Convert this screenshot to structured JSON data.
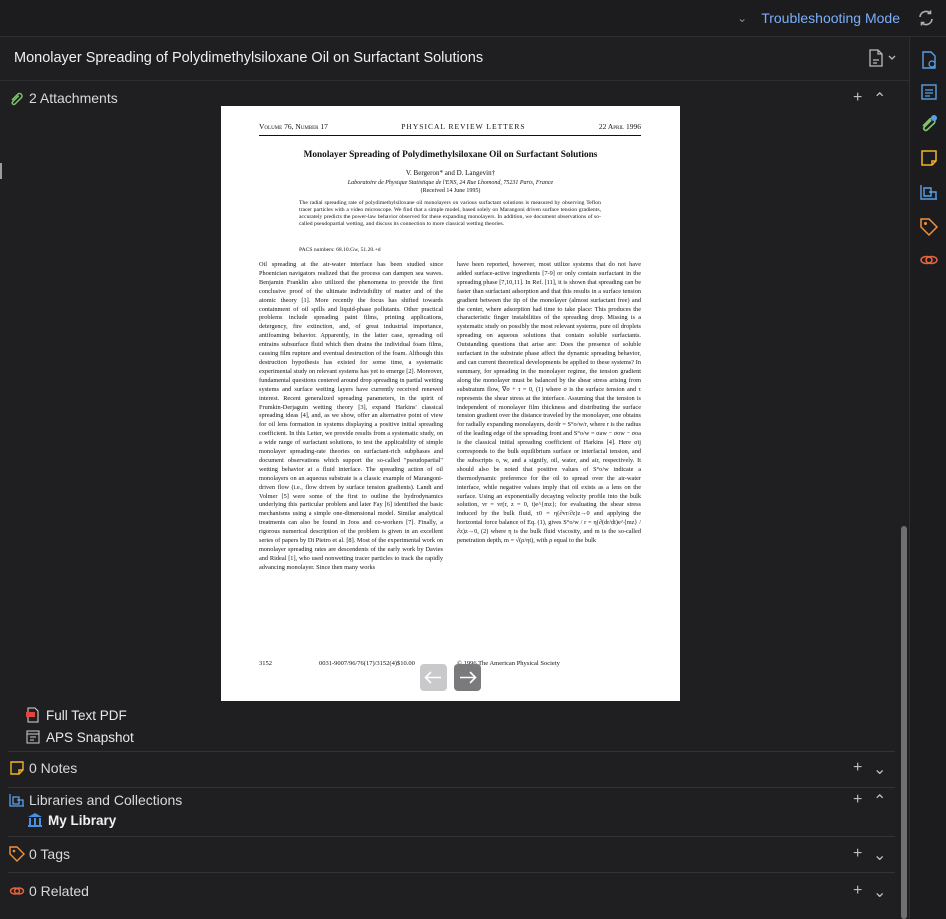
{
  "topbar": {
    "mode_label": "Troubleshooting Mode",
    "chevron_icon": "chevron-down-icon",
    "refresh_icon": "sync-icon"
  },
  "item": {
    "title": "Monolayer Spreading of Polydimethylsiloxane Oil on Surfactant Solutions"
  },
  "sections": {
    "attachments": {
      "label": "2 Attachments"
    },
    "notes": {
      "label": "0 Notes"
    },
    "libraries": {
      "label": "Libraries and Collections"
    },
    "tags": {
      "label": "0 Tags"
    },
    "related": {
      "label": "0 Related"
    }
  },
  "attachments": [
    {
      "label": "Full Text PDF",
      "icon": "pdf-icon"
    },
    {
      "label": "APS Snapshot",
      "icon": "snapshot-icon"
    }
  ],
  "library": {
    "label": "My Library",
    "icon": "library-icon"
  },
  "preview": {
    "header_left": "Volume 76, Number 17",
    "header_center": "PHYSICAL REVIEW LETTERS",
    "header_right": "22 April 1996",
    "title": "Monolayer Spreading of Polydimethylsiloxane Oil on Surfactant Solutions",
    "authors": "V. Bergeron* and D. Langevin†",
    "affiliation": "Laboratoire de Physique Statistique de l'ENS, 24 Rue Lhomond, 75231 Paris, France",
    "received": "(Received 14 June 1995)",
    "abstract": "The radial spreading rate of polydimethylsiloxane oil monolayers on various surfactant solutions is measured by observing Teflon tracer particles with a video microscope. We find that a simple model, based solely on Marangoni driven surface tension gradients, accurately predicts the power-law behavior observed for these expanding monolayers. In addition, we document observations of so-called pseudopartial wetting, and discuss its connection to more classical wetting theories.",
    "pacs": "PACS numbers: 68.10.Gw, 51.20.+d",
    "col1": "Oil spreading at the air-water interface has been studied since Phoenician navigators realized that the process can dampen sea waves. Benjamin Franklin also utilized the phenomena to provide the first conclusive proof of the ultimate indivisibility of matter and of the atomic theory [1]. More recently the focus has shifted towards containment of oil spills and liquid-phase pollutants. Other practical problems include spreading paint films, printing applications, detergency, fire extinction, and, of great industrial importance, antifoaming behavior. Apparently, in the latter case, spreading oil entrains subsurface fluid which then drains the individual foam films, causing film rupture and eventual destruction of the foam. Although this destruction hypothesis has existed for some time, a systematic experimental study on relevant systems has yet to emerge [2]. Moreover, fundamental questions centered around drop spreading in partial wetting systems and surface wetting layers have currently received renewed interest. Recent generalized spreading parameters, in the spirit of Frumkin-Derjaguin wetting theory [3], expand Harkins' classical spreading ideas [4], and, as we show, offer an alternative point of view for oil lens formation in systems displaying a positive initial spreading coefficient. In this Letter, we provide results from a systematic study, on a wide range of surfactant solutions, to test the applicability of simple monolayer spreading-rate theories on surfactant-rich subphases and document observations which support the so-called \"pseudopartial\" wetting behavior at a fluid interface. The spreading action of oil monolayers on an aqueous substrate is a classic example of Marangoni-driven flow (i.e., flow driven by surface tension gradients). Landt and Volmer [5] were some of the first to outline the hydrodynamics underlying this particular problem and later Fay [6] identified the basic mechanisms using a simple one-dimensional model. Similar analytical treatments can also be found in Joos and co-workers [7]. Finally, a rigorous numerical description of the problem is given in an excellent series of papers by Di Pietro et al. [8]. Most of the experimental work on monolayer spreading rates are descendents of the early work by Davies and Rideal [1], who used nonwetting tracer particles to track the rapidly advancing monolayer. Since then many works",
    "col2": "have been reported, however, most utilize systems that do not have added surface-active ingredients [7-9] or only contain surfactant in the spreading phase [7,10,11]. In Ref. [11], it is shown that spreading can be faster than surfactant adsorption and that this results in a surface tension gradient between the tip of the monolayer (almost surfactant free) and the center, where adsorption had time to take place: This produces the characteristic finger instabilities of the spreading drop. Missing is a systematic study on possibly the most relevant systems, pure oil droplets spreading on aqueous solutions that contain soluble surfactants. Outstanding questions that arise are: Does the presence of soluble surfactant in the substrate phase affect the dynamic spreading behavior, and can current theoretical developments be applied to these systems? In summary, for spreading in the monolayer regime, the tension gradient along the monolayer must be balanced by the shear stress arising from substratum flow, ∇σ + τ = 0, (1) where σ is the surface tension and τ represents the shear stress at the interface. Assuming that the tension is independent of monolayer film thickness and distributing the surface tension gradient over the distance traveled by the monolayer, one obtains for radially expanding monolayers, dσ/dr = S°o/w/r, where r is the radius of the leading edge of the spreading front and S°o/w = σaw − σow − σoa is the classical initial spreading coefficient of Harkins [4]. Here σij corresponds to the bulk equilibrium surface or interfacial tension, and the subscripts o, w, and a signify, oil, water, and air, respectively. It should also be noted that positive values of S°o/w indicate a thermodynamic preference for the oil to spread over the air-water interface, while negative values imply that oil exists as a lens on the surface. Using an exponentially decaying velocity profile into the bulk solution, vr = vr(r, z = 0, t)e^{mz}; for evaluating the shear stress induced by the bulk fluid, τ0 = η(∂vr/∂z)z→0 and applying the horizontal force balance of Eq. (1), gives S°o/w / r = η(∂(dr/dt)e^{mz} / ∂z)z→0, (2) where η is the bulk fluid viscosity, and m is the so-called penetration depth, m = √(ρ/ηt), with ρ equal to the bulk",
    "page_number": "3152",
    "code": "0031-9007/96/76(17)/3152(4)$10.00",
    "copyright": "© 1996 The American Physical Society"
  }
}
